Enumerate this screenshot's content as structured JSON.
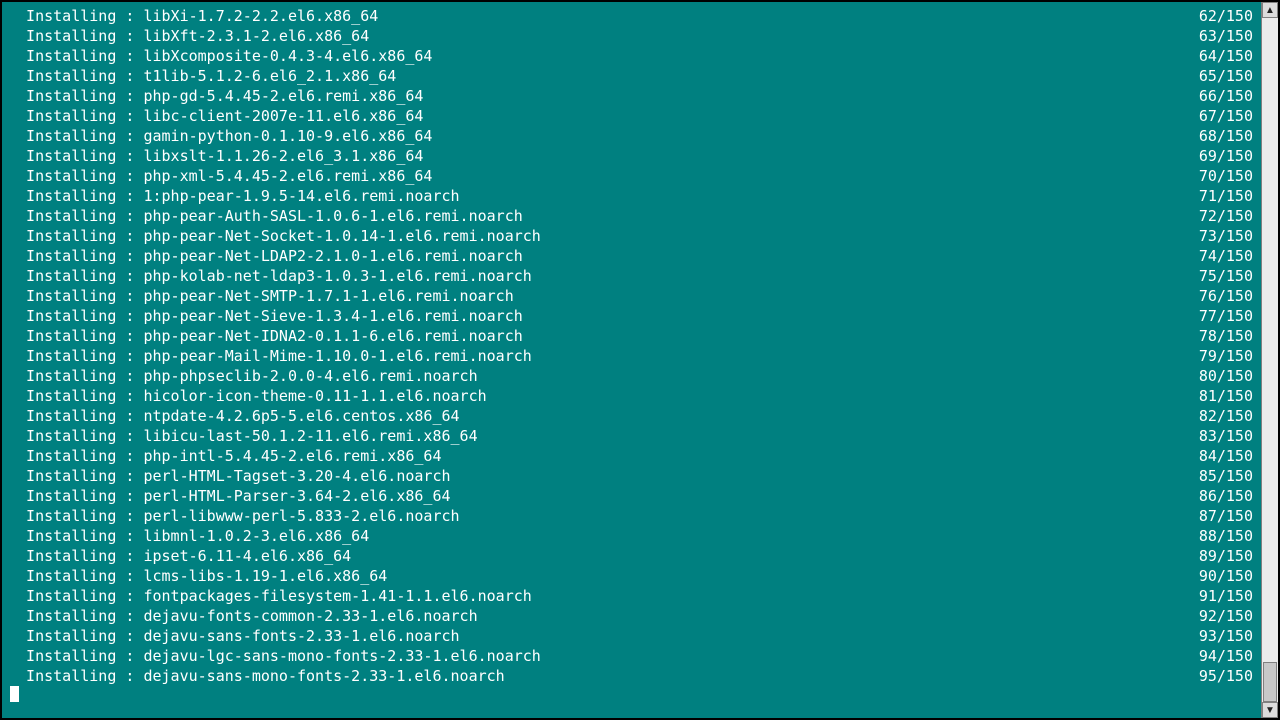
{
  "terminal": {
    "action_label": "Installing",
    "separator": " : ",
    "lines": [
      {
        "pkg": "libXi-1.7.2-2.2.el6.x86_64",
        "n": 62,
        "total": 150
      },
      {
        "pkg": "libXft-2.3.1-2.el6.x86_64",
        "n": 63,
        "total": 150
      },
      {
        "pkg": "libXcomposite-0.4.3-4.el6.x86_64",
        "n": 64,
        "total": 150
      },
      {
        "pkg": "t1lib-5.1.2-6.el6_2.1.x86_64",
        "n": 65,
        "total": 150
      },
      {
        "pkg": "php-gd-5.4.45-2.el6.remi.x86_64",
        "n": 66,
        "total": 150
      },
      {
        "pkg": "libc-client-2007e-11.el6.x86_64",
        "n": 67,
        "total": 150
      },
      {
        "pkg": "gamin-python-0.1.10-9.el6.x86_64",
        "n": 68,
        "total": 150
      },
      {
        "pkg": "libxslt-1.1.26-2.el6_3.1.x86_64",
        "n": 69,
        "total": 150
      },
      {
        "pkg": "php-xml-5.4.45-2.el6.remi.x86_64",
        "n": 70,
        "total": 150
      },
      {
        "pkg": "1:php-pear-1.9.5-14.el6.remi.noarch",
        "n": 71,
        "total": 150
      },
      {
        "pkg": "php-pear-Auth-SASL-1.0.6-1.el6.remi.noarch",
        "n": 72,
        "total": 150
      },
      {
        "pkg": "php-pear-Net-Socket-1.0.14-1.el6.remi.noarch",
        "n": 73,
        "total": 150
      },
      {
        "pkg": "php-pear-Net-LDAP2-2.1.0-1.el6.remi.noarch",
        "n": 74,
        "total": 150
      },
      {
        "pkg": "php-kolab-net-ldap3-1.0.3-1.el6.remi.noarch",
        "n": 75,
        "total": 150
      },
      {
        "pkg": "php-pear-Net-SMTP-1.7.1-1.el6.remi.noarch",
        "n": 76,
        "total": 150
      },
      {
        "pkg": "php-pear-Net-Sieve-1.3.4-1.el6.remi.noarch",
        "n": 77,
        "total": 150
      },
      {
        "pkg": "php-pear-Net-IDNA2-0.1.1-6.el6.remi.noarch",
        "n": 78,
        "total": 150
      },
      {
        "pkg": "php-pear-Mail-Mime-1.10.0-1.el6.remi.noarch",
        "n": 79,
        "total": 150
      },
      {
        "pkg": "php-phpseclib-2.0.0-4.el6.remi.noarch",
        "n": 80,
        "total": 150
      },
      {
        "pkg": "hicolor-icon-theme-0.11-1.1.el6.noarch",
        "n": 81,
        "total": 150
      },
      {
        "pkg": "ntpdate-4.2.6p5-5.el6.centos.x86_64",
        "n": 82,
        "total": 150
      },
      {
        "pkg": "libicu-last-50.1.2-11.el6.remi.x86_64",
        "n": 83,
        "total": 150
      },
      {
        "pkg": "php-intl-5.4.45-2.el6.remi.x86_64",
        "n": 84,
        "total": 150
      },
      {
        "pkg": "perl-HTML-Tagset-3.20-4.el6.noarch",
        "n": 85,
        "total": 150
      },
      {
        "pkg": "perl-HTML-Parser-3.64-2.el6.x86_64",
        "n": 86,
        "total": 150
      },
      {
        "pkg": "perl-libwww-perl-5.833-2.el6.noarch",
        "n": 87,
        "total": 150
      },
      {
        "pkg": "libmnl-1.0.2-3.el6.x86_64",
        "n": 88,
        "total": 150
      },
      {
        "pkg": "ipset-6.11-4.el6.x86_64",
        "n": 89,
        "total": 150
      },
      {
        "pkg": "lcms-libs-1.19-1.el6.x86_64",
        "n": 90,
        "total": 150
      },
      {
        "pkg": "fontpackages-filesystem-1.41-1.1.el6.noarch",
        "n": 91,
        "total": 150
      },
      {
        "pkg": "dejavu-fonts-common-2.33-1.el6.noarch",
        "n": 92,
        "total": 150
      },
      {
        "pkg": "dejavu-sans-fonts-2.33-1.el6.noarch",
        "n": 93,
        "total": 150
      },
      {
        "pkg": "dejavu-lgc-sans-mono-fonts-2.33-1.el6.noarch",
        "n": 94,
        "total": 150
      },
      {
        "pkg": "dejavu-sans-mono-fonts-2.33-1.el6.noarch",
        "n": 95,
        "total": 150
      }
    ]
  },
  "scrollbar": {
    "up_glyph": "▲",
    "down_glyph": "▼"
  }
}
